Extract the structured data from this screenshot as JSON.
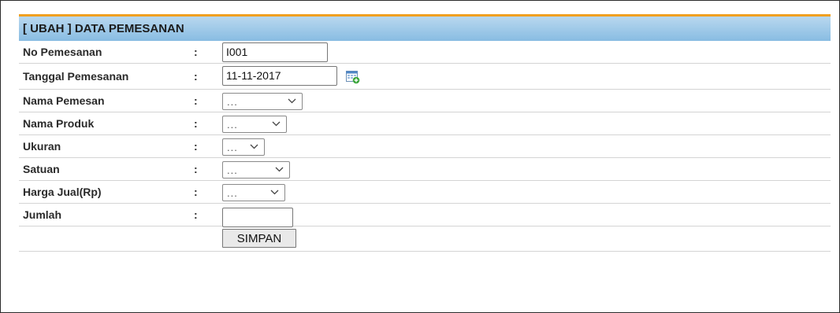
{
  "form": {
    "title": "[ UBAH ] DATA PEMESANAN",
    "no_pemesanan": {
      "label": "No Pemesanan",
      "colon": ":",
      "value": "I001"
    },
    "tanggal_pemesanan": {
      "label": "Tanggal Pemesanan",
      "colon": ":",
      "value": "11-11-2017",
      "icon": "calendar-add-icon"
    },
    "nama_pemesan": {
      "label": "Nama Pemesan",
      "colon": ":",
      "selected": "..."
    },
    "nama_produk": {
      "label": "Nama Produk",
      "colon": ":",
      "selected": "..."
    },
    "ukuran": {
      "label": "Ukuran",
      "colon": ":",
      "selected": "..."
    },
    "satuan": {
      "label": "Satuan",
      "colon": ":",
      "selected": "..."
    },
    "harga_jual": {
      "label": "Harga Jual(Rp)",
      "colon": ":",
      "selected": "..."
    },
    "jumlah": {
      "label": "Jumlah",
      "colon": ":",
      "value": ""
    },
    "submit_label": "SIMPAN"
  },
  "colors": {
    "header_gradient_top": "#b9d8ef",
    "header_gradient_bottom": "#88bce2",
    "header_accent": "#f0a020",
    "row_divider": "#d4d4d4"
  }
}
